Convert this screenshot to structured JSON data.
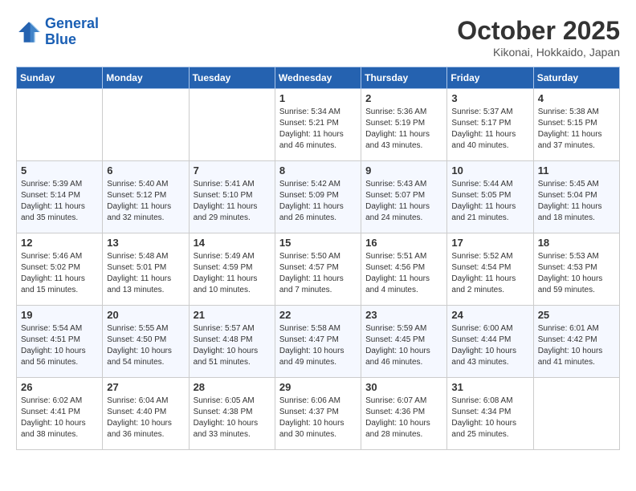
{
  "header": {
    "logo_line1": "General",
    "logo_line2": "Blue",
    "month": "October 2025",
    "location": "Kikonai, Hokkaido, Japan"
  },
  "weekdays": [
    "Sunday",
    "Monday",
    "Tuesday",
    "Wednesday",
    "Thursday",
    "Friday",
    "Saturday"
  ],
  "weeks": [
    [
      {
        "day": "",
        "sunrise": "",
        "sunset": "",
        "daylight": ""
      },
      {
        "day": "",
        "sunrise": "",
        "sunset": "",
        "daylight": ""
      },
      {
        "day": "",
        "sunrise": "",
        "sunset": "",
        "daylight": ""
      },
      {
        "day": "1",
        "sunrise": "Sunrise: 5:34 AM",
        "sunset": "Sunset: 5:21 PM",
        "daylight": "Daylight: 11 hours and 46 minutes."
      },
      {
        "day": "2",
        "sunrise": "Sunrise: 5:36 AM",
        "sunset": "Sunset: 5:19 PM",
        "daylight": "Daylight: 11 hours and 43 minutes."
      },
      {
        "day": "3",
        "sunrise": "Sunrise: 5:37 AM",
        "sunset": "Sunset: 5:17 PM",
        "daylight": "Daylight: 11 hours and 40 minutes."
      },
      {
        "day": "4",
        "sunrise": "Sunrise: 5:38 AM",
        "sunset": "Sunset: 5:15 PM",
        "daylight": "Daylight: 11 hours and 37 minutes."
      }
    ],
    [
      {
        "day": "5",
        "sunrise": "Sunrise: 5:39 AM",
        "sunset": "Sunset: 5:14 PM",
        "daylight": "Daylight: 11 hours and 35 minutes."
      },
      {
        "day": "6",
        "sunrise": "Sunrise: 5:40 AM",
        "sunset": "Sunset: 5:12 PM",
        "daylight": "Daylight: 11 hours and 32 minutes."
      },
      {
        "day": "7",
        "sunrise": "Sunrise: 5:41 AM",
        "sunset": "Sunset: 5:10 PM",
        "daylight": "Daylight: 11 hours and 29 minutes."
      },
      {
        "day": "8",
        "sunrise": "Sunrise: 5:42 AM",
        "sunset": "Sunset: 5:09 PM",
        "daylight": "Daylight: 11 hours and 26 minutes."
      },
      {
        "day": "9",
        "sunrise": "Sunrise: 5:43 AM",
        "sunset": "Sunset: 5:07 PM",
        "daylight": "Daylight: 11 hours and 24 minutes."
      },
      {
        "day": "10",
        "sunrise": "Sunrise: 5:44 AM",
        "sunset": "Sunset: 5:05 PM",
        "daylight": "Daylight: 11 hours and 21 minutes."
      },
      {
        "day": "11",
        "sunrise": "Sunrise: 5:45 AM",
        "sunset": "Sunset: 5:04 PM",
        "daylight": "Daylight: 11 hours and 18 minutes."
      }
    ],
    [
      {
        "day": "12",
        "sunrise": "Sunrise: 5:46 AM",
        "sunset": "Sunset: 5:02 PM",
        "daylight": "Daylight: 11 hours and 15 minutes."
      },
      {
        "day": "13",
        "sunrise": "Sunrise: 5:48 AM",
        "sunset": "Sunset: 5:01 PM",
        "daylight": "Daylight: 11 hours and 13 minutes."
      },
      {
        "day": "14",
        "sunrise": "Sunrise: 5:49 AM",
        "sunset": "Sunset: 4:59 PM",
        "daylight": "Daylight: 11 hours and 10 minutes."
      },
      {
        "day": "15",
        "sunrise": "Sunrise: 5:50 AM",
        "sunset": "Sunset: 4:57 PM",
        "daylight": "Daylight: 11 hours and 7 minutes."
      },
      {
        "day": "16",
        "sunrise": "Sunrise: 5:51 AM",
        "sunset": "Sunset: 4:56 PM",
        "daylight": "Daylight: 11 hours and 4 minutes."
      },
      {
        "day": "17",
        "sunrise": "Sunrise: 5:52 AM",
        "sunset": "Sunset: 4:54 PM",
        "daylight": "Daylight: 11 hours and 2 minutes."
      },
      {
        "day": "18",
        "sunrise": "Sunrise: 5:53 AM",
        "sunset": "Sunset: 4:53 PM",
        "daylight": "Daylight: 10 hours and 59 minutes."
      }
    ],
    [
      {
        "day": "19",
        "sunrise": "Sunrise: 5:54 AM",
        "sunset": "Sunset: 4:51 PM",
        "daylight": "Daylight: 10 hours and 56 minutes."
      },
      {
        "day": "20",
        "sunrise": "Sunrise: 5:55 AM",
        "sunset": "Sunset: 4:50 PM",
        "daylight": "Daylight: 10 hours and 54 minutes."
      },
      {
        "day": "21",
        "sunrise": "Sunrise: 5:57 AM",
        "sunset": "Sunset: 4:48 PM",
        "daylight": "Daylight: 10 hours and 51 minutes."
      },
      {
        "day": "22",
        "sunrise": "Sunrise: 5:58 AM",
        "sunset": "Sunset: 4:47 PM",
        "daylight": "Daylight: 10 hours and 49 minutes."
      },
      {
        "day": "23",
        "sunrise": "Sunrise: 5:59 AM",
        "sunset": "Sunset: 4:45 PM",
        "daylight": "Daylight: 10 hours and 46 minutes."
      },
      {
        "day": "24",
        "sunrise": "Sunrise: 6:00 AM",
        "sunset": "Sunset: 4:44 PM",
        "daylight": "Daylight: 10 hours and 43 minutes."
      },
      {
        "day": "25",
        "sunrise": "Sunrise: 6:01 AM",
        "sunset": "Sunset: 4:42 PM",
        "daylight": "Daylight: 10 hours and 41 minutes."
      }
    ],
    [
      {
        "day": "26",
        "sunrise": "Sunrise: 6:02 AM",
        "sunset": "Sunset: 4:41 PM",
        "daylight": "Daylight: 10 hours and 38 minutes."
      },
      {
        "day": "27",
        "sunrise": "Sunrise: 6:04 AM",
        "sunset": "Sunset: 4:40 PM",
        "daylight": "Daylight: 10 hours and 36 minutes."
      },
      {
        "day": "28",
        "sunrise": "Sunrise: 6:05 AM",
        "sunset": "Sunset: 4:38 PM",
        "daylight": "Daylight: 10 hours and 33 minutes."
      },
      {
        "day": "29",
        "sunrise": "Sunrise: 6:06 AM",
        "sunset": "Sunset: 4:37 PM",
        "daylight": "Daylight: 10 hours and 30 minutes."
      },
      {
        "day": "30",
        "sunrise": "Sunrise: 6:07 AM",
        "sunset": "Sunset: 4:36 PM",
        "daylight": "Daylight: 10 hours and 28 minutes."
      },
      {
        "day": "31",
        "sunrise": "Sunrise: 6:08 AM",
        "sunset": "Sunset: 4:34 PM",
        "daylight": "Daylight: 10 hours and 25 minutes."
      },
      {
        "day": "",
        "sunrise": "",
        "sunset": "",
        "daylight": ""
      }
    ]
  ]
}
